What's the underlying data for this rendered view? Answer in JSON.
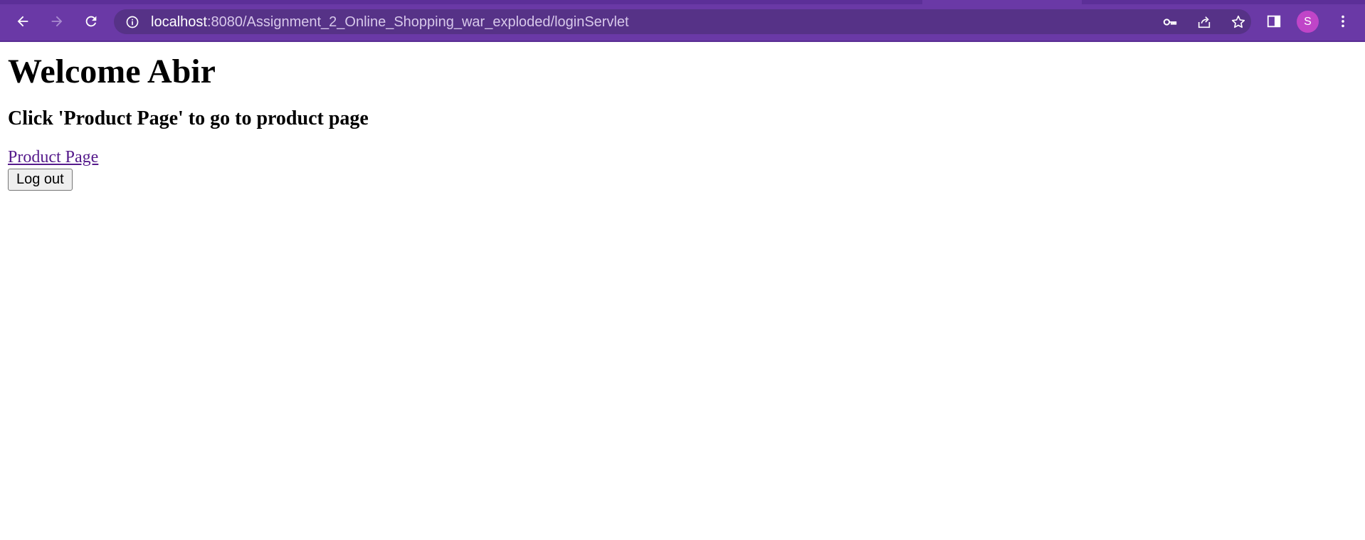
{
  "browser": {
    "url_host": "localhost",
    "url_rest": ":8080/Assignment_2_Online_Shopping_war_exploded/loginServlet",
    "profile_initial": "S",
    "colors": {
      "toolbar": "#6a39a6",
      "omnibox": "#563287",
      "avatar": "#c045c8"
    },
    "icons": {
      "back": "arrow-left-icon",
      "forward": "arrow-right-icon",
      "reload": "reload-icon",
      "site_info": "info-circle-icon",
      "password": "key-icon",
      "share": "share-icon",
      "bookmark": "star-icon",
      "side_panel": "side-panel-icon",
      "menu": "more-vertical-icon"
    }
  },
  "page": {
    "welcome_heading": "Welcome Abir",
    "instruction": "Click 'Product Page' to go to product page",
    "product_link_label": "Product Page",
    "logout_label": "Log out",
    "link_color": "#551a8b"
  }
}
